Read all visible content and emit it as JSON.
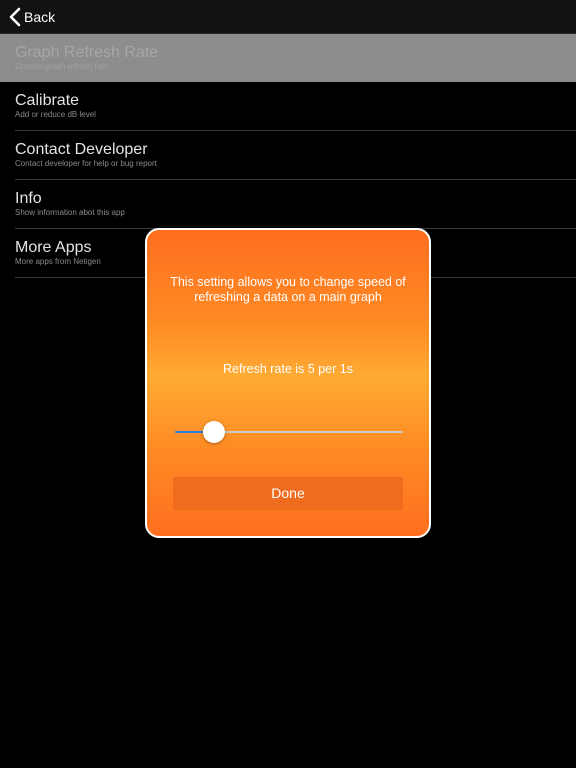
{
  "navbar": {
    "back_label": "Back",
    "back_icon": "chevron-left-icon"
  },
  "menu": {
    "items": [
      {
        "title": "Graph Refresh Rate",
        "subtitle": "Choose graph refresh rate",
        "selected": true
      },
      {
        "title": "Calibrate",
        "subtitle": "Add or reduce dB level"
      },
      {
        "title": "Contact Developer",
        "subtitle": "Contact developer for help or bug report"
      },
      {
        "title": "Info",
        "subtitle": "Show information abot this app"
      },
      {
        "title": "More Apps",
        "subtitle": "More apps from Netigen"
      }
    ]
  },
  "dialog": {
    "message": "This setting allows you to change speed of refreshing a data on a main graph",
    "rate_text": "Refresh rate is 5 per 1s",
    "slider_fraction": 0.17,
    "done_label": "Done"
  },
  "colors": {
    "background": "#000000",
    "selected_row": "#8d8d8d",
    "dialog_orange": "#ff7a1f",
    "slider_fill": "#2f7bf0",
    "done_button": "#ef6c1e"
  }
}
